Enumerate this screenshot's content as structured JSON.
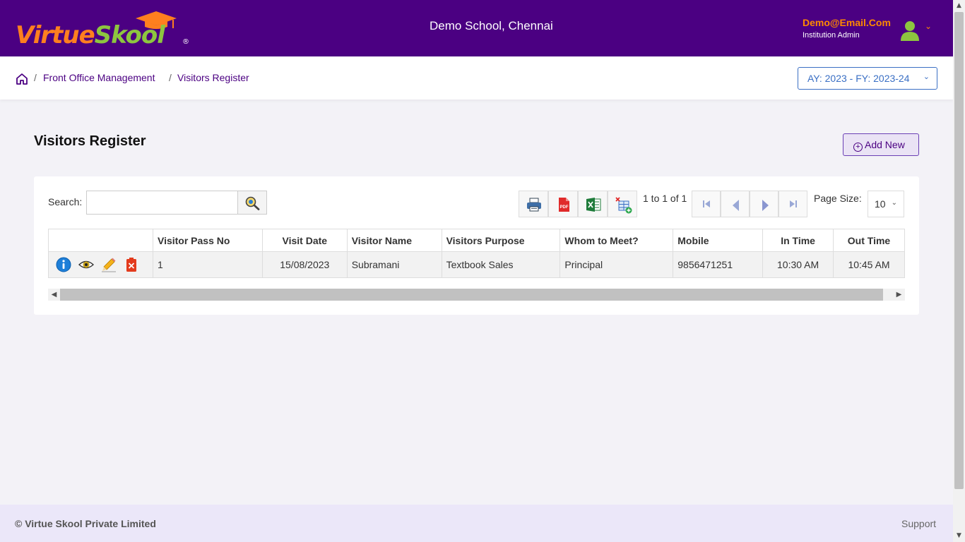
{
  "brand": {
    "logo_part1": "Virtue",
    "logo_part2": "Skool",
    "registered": "®"
  },
  "header": {
    "school_name": "Demo School, Chennai",
    "user_email": "Demo@Email.Com",
    "user_role": "Institution Admin",
    "user_menu_caret": "⌄"
  },
  "breadcrumb": {
    "items": [
      "Front Office Management",
      "Visitors Register"
    ],
    "separator": "/"
  },
  "academic_year": {
    "label": "AY: 2023 - FY: 2023-24",
    "caret": "⌄"
  },
  "page": {
    "title": "Visitors Register",
    "add_new_label": "Add New"
  },
  "toolbar": {
    "search_label": "Search:",
    "search_value": "",
    "pager_info": "1 to 1 of 1",
    "page_size_label": "Page Size:",
    "page_size_value": "10",
    "icons": [
      "print-icon",
      "pdf-icon",
      "excel-icon",
      "column-chooser-icon"
    ]
  },
  "table": {
    "columns": [
      "",
      "Visitor Pass No",
      "Visit Date",
      "Visitor Name",
      "Visitors Purpose",
      "Whom to Meet?",
      "Mobile",
      "In Time",
      "Out Time"
    ],
    "rows": [
      {
        "pass_no": "1",
        "visit_date": "15/08/2023",
        "visitor_name": "Subramani",
        "purpose": "Textbook Sales",
        "whom_to_meet": "Principal",
        "mobile": "9856471251",
        "in_time": "10:30 AM",
        "out_time": "10:45 AM"
      }
    ]
  },
  "footer": {
    "copyright": "© Virtue Skool Private Limited",
    "support": "Support"
  },
  "colors": {
    "header_bg": "#4b0082",
    "accent_orange": "#ff7f1f",
    "accent_green": "#8dc63f",
    "link_blue": "#3a6fc4",
    "footer_bg": "#ebe7f9"
  }
}
